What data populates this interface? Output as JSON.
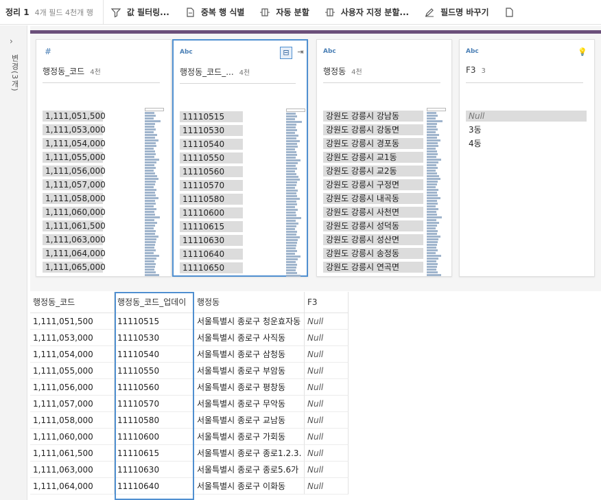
{
  "toolbar": {
    "title": "정리 1",
    "meta": "4개 필드  4천개 행",
    "buttons": [
      "값 필터링...",
      "중복 행 식별",
      "자동 분할",
      "사용자 지정 분할...",
      "필드명 바꾸기"
    ]
  },
  "left_panel": {
    "label": "변경(3개)"
  },
  "cards": [
    {
      "type": "#",
      "name": "행정동_코드",
      "count": "4천",
      "values": [
        "1,111,051,500",
        "1,111,053,000",
        "1,111,054,000",
        "1,111,055,000",
        "1,111,056,000",
        "1,111,057,000",
        "1,111,058,000",
        "1,111,060,000",
        "1,111,061,500",
        "1,111,063,000",
        "1,111,064,000",
        "1,111,065,000"
      ],
      "bar_fraction": [
        0.54,
        0.54,
        0.54,
        0.54,
        0.54,
        0.54,
        0.54,
        0.54,
        0.54,
        0.54,
        0.54,
        0.54
      ]
    },
    {
      "type": "Abc",
      "name": "행정동_코드_...",
      "count": "4천",
      "values": [
        "11110515",
        "11110530",
        "11110540",
        "11110550",
        "11110560",
        "11110570",
        "11110580",
        "11110600",
        "11110615",
        "11110630",
        "11110640",
        "11110650"
      ],
      "bar_fraction": [
        0.46,
        0.46,
        0.46,
        0.46,
        0.46,
        0.46,
        0.46,
        0.46,
        0.46,
        0.46,
        0.46,
        0.46
      ]
    },
    {
      "type": "Abc",
      "name": "행정동",
      "count": "4천",
      "values": [
        "강원도 강릉시 강남동",
        "강원도 강릉시 강동면",
        "강원도 강릉시 경포동",
        "강원도 강릉시 교1동",
        "강원도 강릉시 교2동",
        "강원도 강릉시 구정면",
        "강원도 강릉시 내곡동",
        "강원도 강릉시 사천면",
        "강원도 강릉시 성덕동",
        "강원도 강릉시 성산면",
        "강원도 강릉시 송정동",
        "강원도 강릉시 연곡면"
      ],
      "bar_fraction": [
        0.82,
        0.82,
        0.82,
        0.82,
        0.82,
        0.82,
        0.82,
        0.82,
        0.82,
        0.82,
        0.82,
        0.82
      ]
    },
    {
      "type": "Abc",
      "name": "F3",
      "count": "3",
      "values": [
        "Null",
        "3동",
        "4동"
      ],
      "bar_fraction": [
        0.98,
        0,
        0
      ]
    }
  ],
  "grid": {
    "headers": [
      "행정동_코드",
      "행정동_코드_업데이",
      "행정동",
      "F3"
    ],
    "rows": [
      [
        "1,111,051,500",
        "11110515",
        "서울특별시 종로구 청운효자동",
        "Null"
      ],
      [
        "1,111,053,000",
        "11110530",
        "서울특별시 종로구 사직동",
        "Null"
      ],
      [
        "1,111,054,000",
        "11110540",
        "서울특별시 종로구 삼청동",
        "Null"
      ],
      [
        "1,111,055,000",
        "11110550",
        "서울특별시 종로구 부암동",
        "Null"
      ],
      [
        "1,111,056,000",
        "11110560",
        "서울특별시 종로구 평창동",
        "Null"
      ],
      [
        "1,111,057,000",
        "11110570",
        "서울특별시 종로구 무악동",
        "Null"
      ],
      [
        "1,111,058,000",
        "11110580",
        "서울특별시 종로구 교남동",
        "Null"
      ],
      [
        "1,111,060,000",
        "11110600",
        "서울특별시 종로구 가회동",
        "Null"
      ],
      [
        "1,111,061,500",
        "11110615",
        "서울특별시 종로구 종로1.2.3.",
        "Null"
      ],
      [
        "1,111,063,000",
        "11110630",
        "서울특별시 종로구 종로5.6가",
        "Null"
      ],
      [
        "1,111,064,000",
        "11110640",
        "서울특별시 종로구 이화동",
        "Null"
      ]
    ]
  },
  "colors": {
    "accent": "#4f8fd0",
    "header_bar": "#6b4f7a",
    "histogram": "#9fb4cc"
  }
}
